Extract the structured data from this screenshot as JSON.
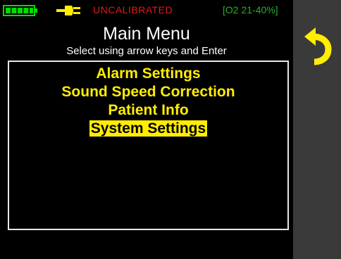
{
  "status": {
    "battery_icon": "battery-full-icon",
    "power_icon": "plug-icon",
    "calibration": "UNCALIBRATED",
    "o2_range": "[O2 21-40%]",
    "colors": {
      "calibration": "#e01a1a",
      "o2_range": "#2eaa2e",
      "battery": "#00dd00",
      "plug": "#ffee00"
    }
  },
  "menu": {
    "title": "Main Menu",
    "subtitle": "Select using arrow keys and Enter",
    "items": [
      {
        "label": "Alarm Settings",
        "selected": false
      },
      {
        "label": "Sound Speed Correction",
        "selected": false
      },
      {
        "label": "Patient Info",
        "selected": false
      },
      {
        "label": "System Settings",
        "selected": true
      }
    ],
    "colors": {
      "item_text": "#ffee00",
      "selected_background": "#ffee00",
      "selected_text": "#000000"
    }
  },
  "side_panel": {
    "back_icon": "back-arrow-icon",
    "colors": {
      "panel": "#3a3a3a",
      "icon": "#ffee00"
    }
  }
}
